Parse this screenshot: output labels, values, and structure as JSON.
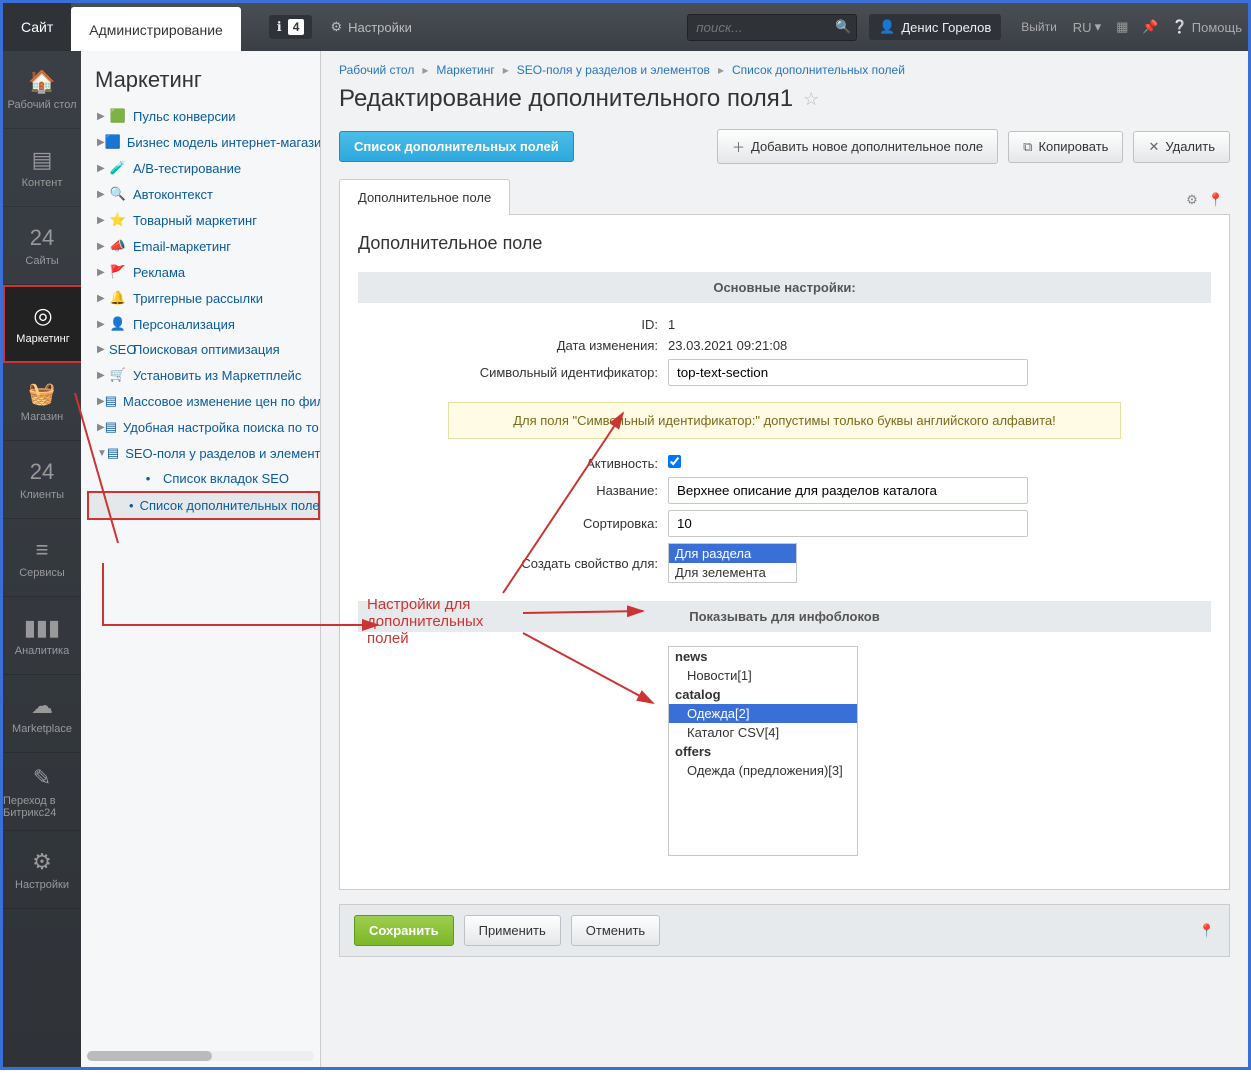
{
  "topbar": {
    "site_tab": "Сайт",
    "admin_tab": "Администрирование",
    "notif_count": "4",
    "settings_label": "Настройки",
    "search_placeholder": "поиск...",
    "user_name": "Денис Горелов",
    "logout": "Выйти",
    "lang": "RU",
    "help": "Помощь"
  },
  "rail": {
    "items": [
      {
        "label": "Рабочий стол",
        "icon": "🏠"
      },
      {
        "label": "Контент",
        "icon": "▤"
      },
      {
        "label": "Сайты",
        "icon": "24"
      },
      {
        "label": "Маркетинг",
        "icon": "◎",
        "active": true
      },
      {
        "label": "Магазин",
        "icon": "🧺"
      },
      {
        "label": "Клиенты",
        "icon": "24"
      },
      {
        "label": "Сервисы",
        "icon": "≡"
      },
      {
        "label": "Аналитика",
        "icon": "▮▮▮"
      },
      {
        "label": "Marketplace",
        "icon": "☁"
      },
      {
        "label": "Переход в Битрикс24",
        "icon": "✎"
      },
      {
        "label": "Настройки",
        "icon": "⚙"
      }
    ]
  },
  "sidebar": {
    "heading": "Маркетинг",
    "nodes": [
      {
        "label": "Пульс конверсии",
        "icon": "🟩"
      },
      {
        "label": "Бизнес модель интернет-магазина",
        "icon": "🟦"
      },
      {
        "label": "А/В-тестирование",
        "icon": "🧪"
      },
      {
        "label": "Автоконтекст",
        "icon": "🔍"
      },
      {
        "label": "Товарный маркетинг",
        "icon": "⭐"
      },
      {
        "label": "Email-маркетинг",
        "icon": "📣"
      },
      {
        "label": "Реклама",
        "icon": "🚩"
      },
      {
        "label": "Триггерные рассылки",
        "icon": "🔔"
      },
      {
        "label": "Персонализация",
        "icon": "👤"
      },
      {
        "label": "Поисковая оптимизация",
        "icon": "SEO"
      },
      {
        "label": "Установить из Маркетплейс",
        "icon": "🛒"
      },
      {
        "label": "Массовое изменение цен по фил.",
        "icon": "▤"
      },
      {
        "label": "Удобная настройка поиска по то",
        "icon": "▤"
      },
      {
        "label": "SEO-поля у разделов и элементов",
        "icon": "▤",
        "expanded": true
      },
      {
        "label": "Список вкладок SEO",
        "sub": true
      },
      {
        "label": "Список дополнительных полей",
        "sub": true,
        "active": true
      }
    ]
  },
  "breadcrumb": [
    "Рабочий стол",
    "Маркетинг",
    "SEO-поля у разделов и элементов",
    "Список дополнительных полей"
  ],
  "page_title": "Редактирование дополнительного поля1",
  "toolbar": {
    "list_btn": "Список дополнительных полей",
    "add_btn": "Добавить новое дополнительное поле",
    "copy_btn": "Копировать",
    "delete_btn": "Удалить"
  },
  "tab": {
    "label": "Дополнительное поле"
  },
  "panel": {
    "heading": "Дополнительное поле",
    "section1": "Основные настройки:",
    "id_lbl": "ID:",
    "id_val": "1",
    "date_lbl": "Дата изменения:",
    "date_val": "23.03.2021 09:21:08",
    "code_lbl": "Символьный идентификатор:",
    "code_val": "top-text-section",
    "warn": "Для поля \"Символьный идентификатор:\" допустимы только буквы английского алфавита!",
    "active_lbl": "Активность:",
    "name_lbl": "Название:",
    "name_val": "Верхнее описание для разделов каталога",
    "sort_lbl": "Сортировка:",
    "sort_val": "10",
    "createfor_lbl": "Создать свойство для:",
    "createfor_opts": [
      "Для раздела",
      "Для зелемента"
    ],
    "section2": "Показывать для инфоблоков",
    "iblocks": [
      {
        "group": "news"
      },
      {
        "item": "Новости[1]"
      },
      {
        "group": "catalog"
      },
      {
        "item": "Одежда[2]",
        "selected": true
      },
      {
        "item": "Каталог CSV[4]"
      },
      {
        "group": "offers"
      },
      {
        "item": "Одежда (предложения)[3]"
      }
    ]
  },
  "annotation": {
    "text1": "Настройки для",
    "text2": "дополнительных",
    "text3": "полей"
  },
  "footer": {
    "save": "Сохранить",
    "apply": "Применить",
    "cancel": "Отменить"
  }
}
